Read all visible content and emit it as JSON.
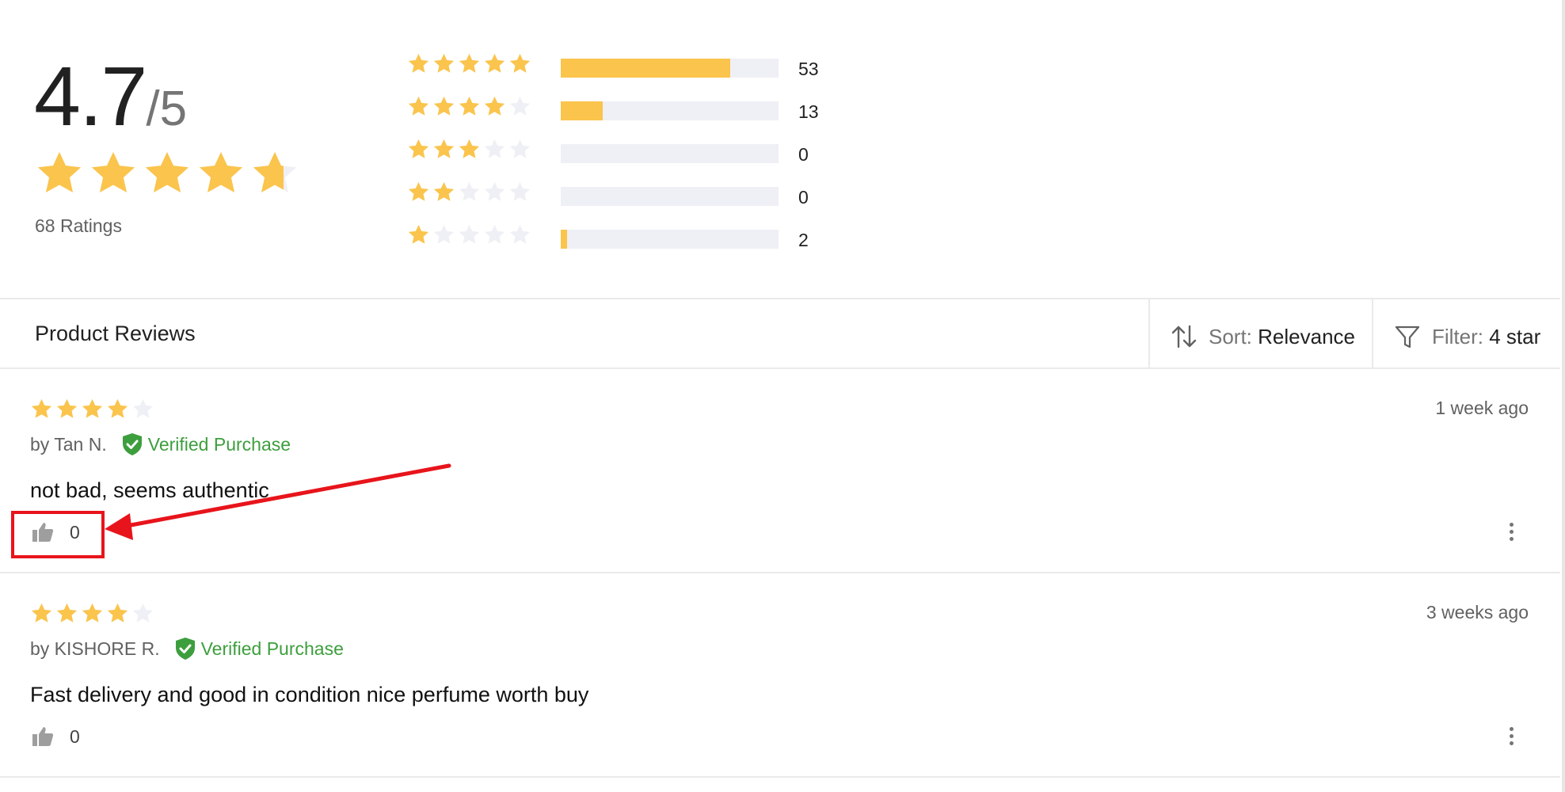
{
  "colors": {
    "star_filled": "#fac44d",
    "star_empty": "#eff0f5",
    "bar_fill": "#fac44d",
    "bar_track": "#eff0f5",
    "verified_green": "#3d9e3d",
    "annotation_red": "#e8141b"
  },
  "summary": {
    "average": "4.7",
    "max": "/5",
    "average_star_fraction": 0.94,
    "ratings_label": "68 Ratings",
    "distribution": [
      {
        "stars": 5,
        "count": "53",
        "fraction": 0.779
      },
      {
        "stars": 4,
        "count": "13",
        "fraction": 0.191
      },
      {
        "stars": 3,
        "count": "0",
        "fraction": 0
      },
      {
        "stars": 2,
        "count": "0",
        "fraction": 0
      },
      {
        "stars": 1,
        "count": "2",
        "fraction": 0.029
      }
    ]
  },
  "header": {
    "title": "Product Reviews",
    "sort_icon": "sort-arrows-icon",
    "sort_key": "Sort:",
    "sort_value": "Relevance",
    "filter_icon": "funnel-icon",
    "filter_key": "Filter:",
    "filter_value": "4 star"
  },
  "reviews": [
    {
      "rating": 4,
      "date": "1 week ago",
      "author": "by Tan N.",
      "verified_label": "Verified Purchase",
      "text": "not bad, seems authentic",
      "likes": "0"
    },
    {
      "rating": 4,
      "date": "3 weeks ago",
      "author": "by KISHORE R.",
      "verified_label": "Verified Purchase",
      "text": "Fast delivery and good in condition nice perfume worth buy",
      "likes": "0"
    }
  ]
}
